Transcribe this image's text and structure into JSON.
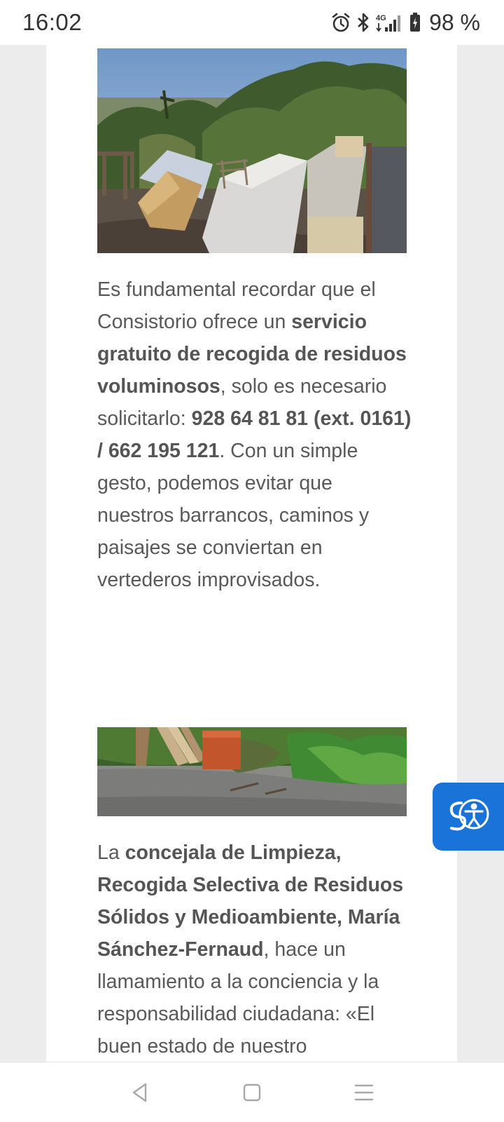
{
  "status_bar": {
    "time": "16:02",
    "icons": [
      "alarm-icon",
      "bluetooth-icon",
      "4g-signal-icon",
      "battery-icon"
    ],
    "network": "4G",
    "battery": "98 %"
  },
  "article": {
    "paragraph_1": {
      "t1": "Es fundamental recordar que el Consistorio ofrece un ",
      "b1": "servicio gratuito de recogida de residuos voluminosos",
      "t2": ", solo es necesario solicitarlo: ",
      "b2": "928 64 81 81 (ext. 0161) / 662 195 121",
      "t3": ". Con un simple gesto, podemos evitar que nuestros barrancos, caminos y paisajes se conviertan en vertederos improvisados."
    },
    "paragraph_2": {
      "t1": "La ",
      "b1": "concejala de Limpieza, Recogida Selectiva de Residuos Sólidos y Medioambiente, María Sánchez-Fernaud",
      "t2": ", hace un llamamiento a la conciencia y la responsabilidad ciudadana:  «El buen estado de nuestro"
    }
  },
  "accessibility_button": {
    "icon": "accessibility-icon"
  },
  "nav_bar": {
    "icons": [
      "back-icon",
      "home-icon",
      "menu-icon"
    ]
  },
  "colors": {
    "accent": "#1a73d9",
    "page_background": "#ececec",
    "card_background": "#ffffff",
    "text": "#595959"
  }
}
